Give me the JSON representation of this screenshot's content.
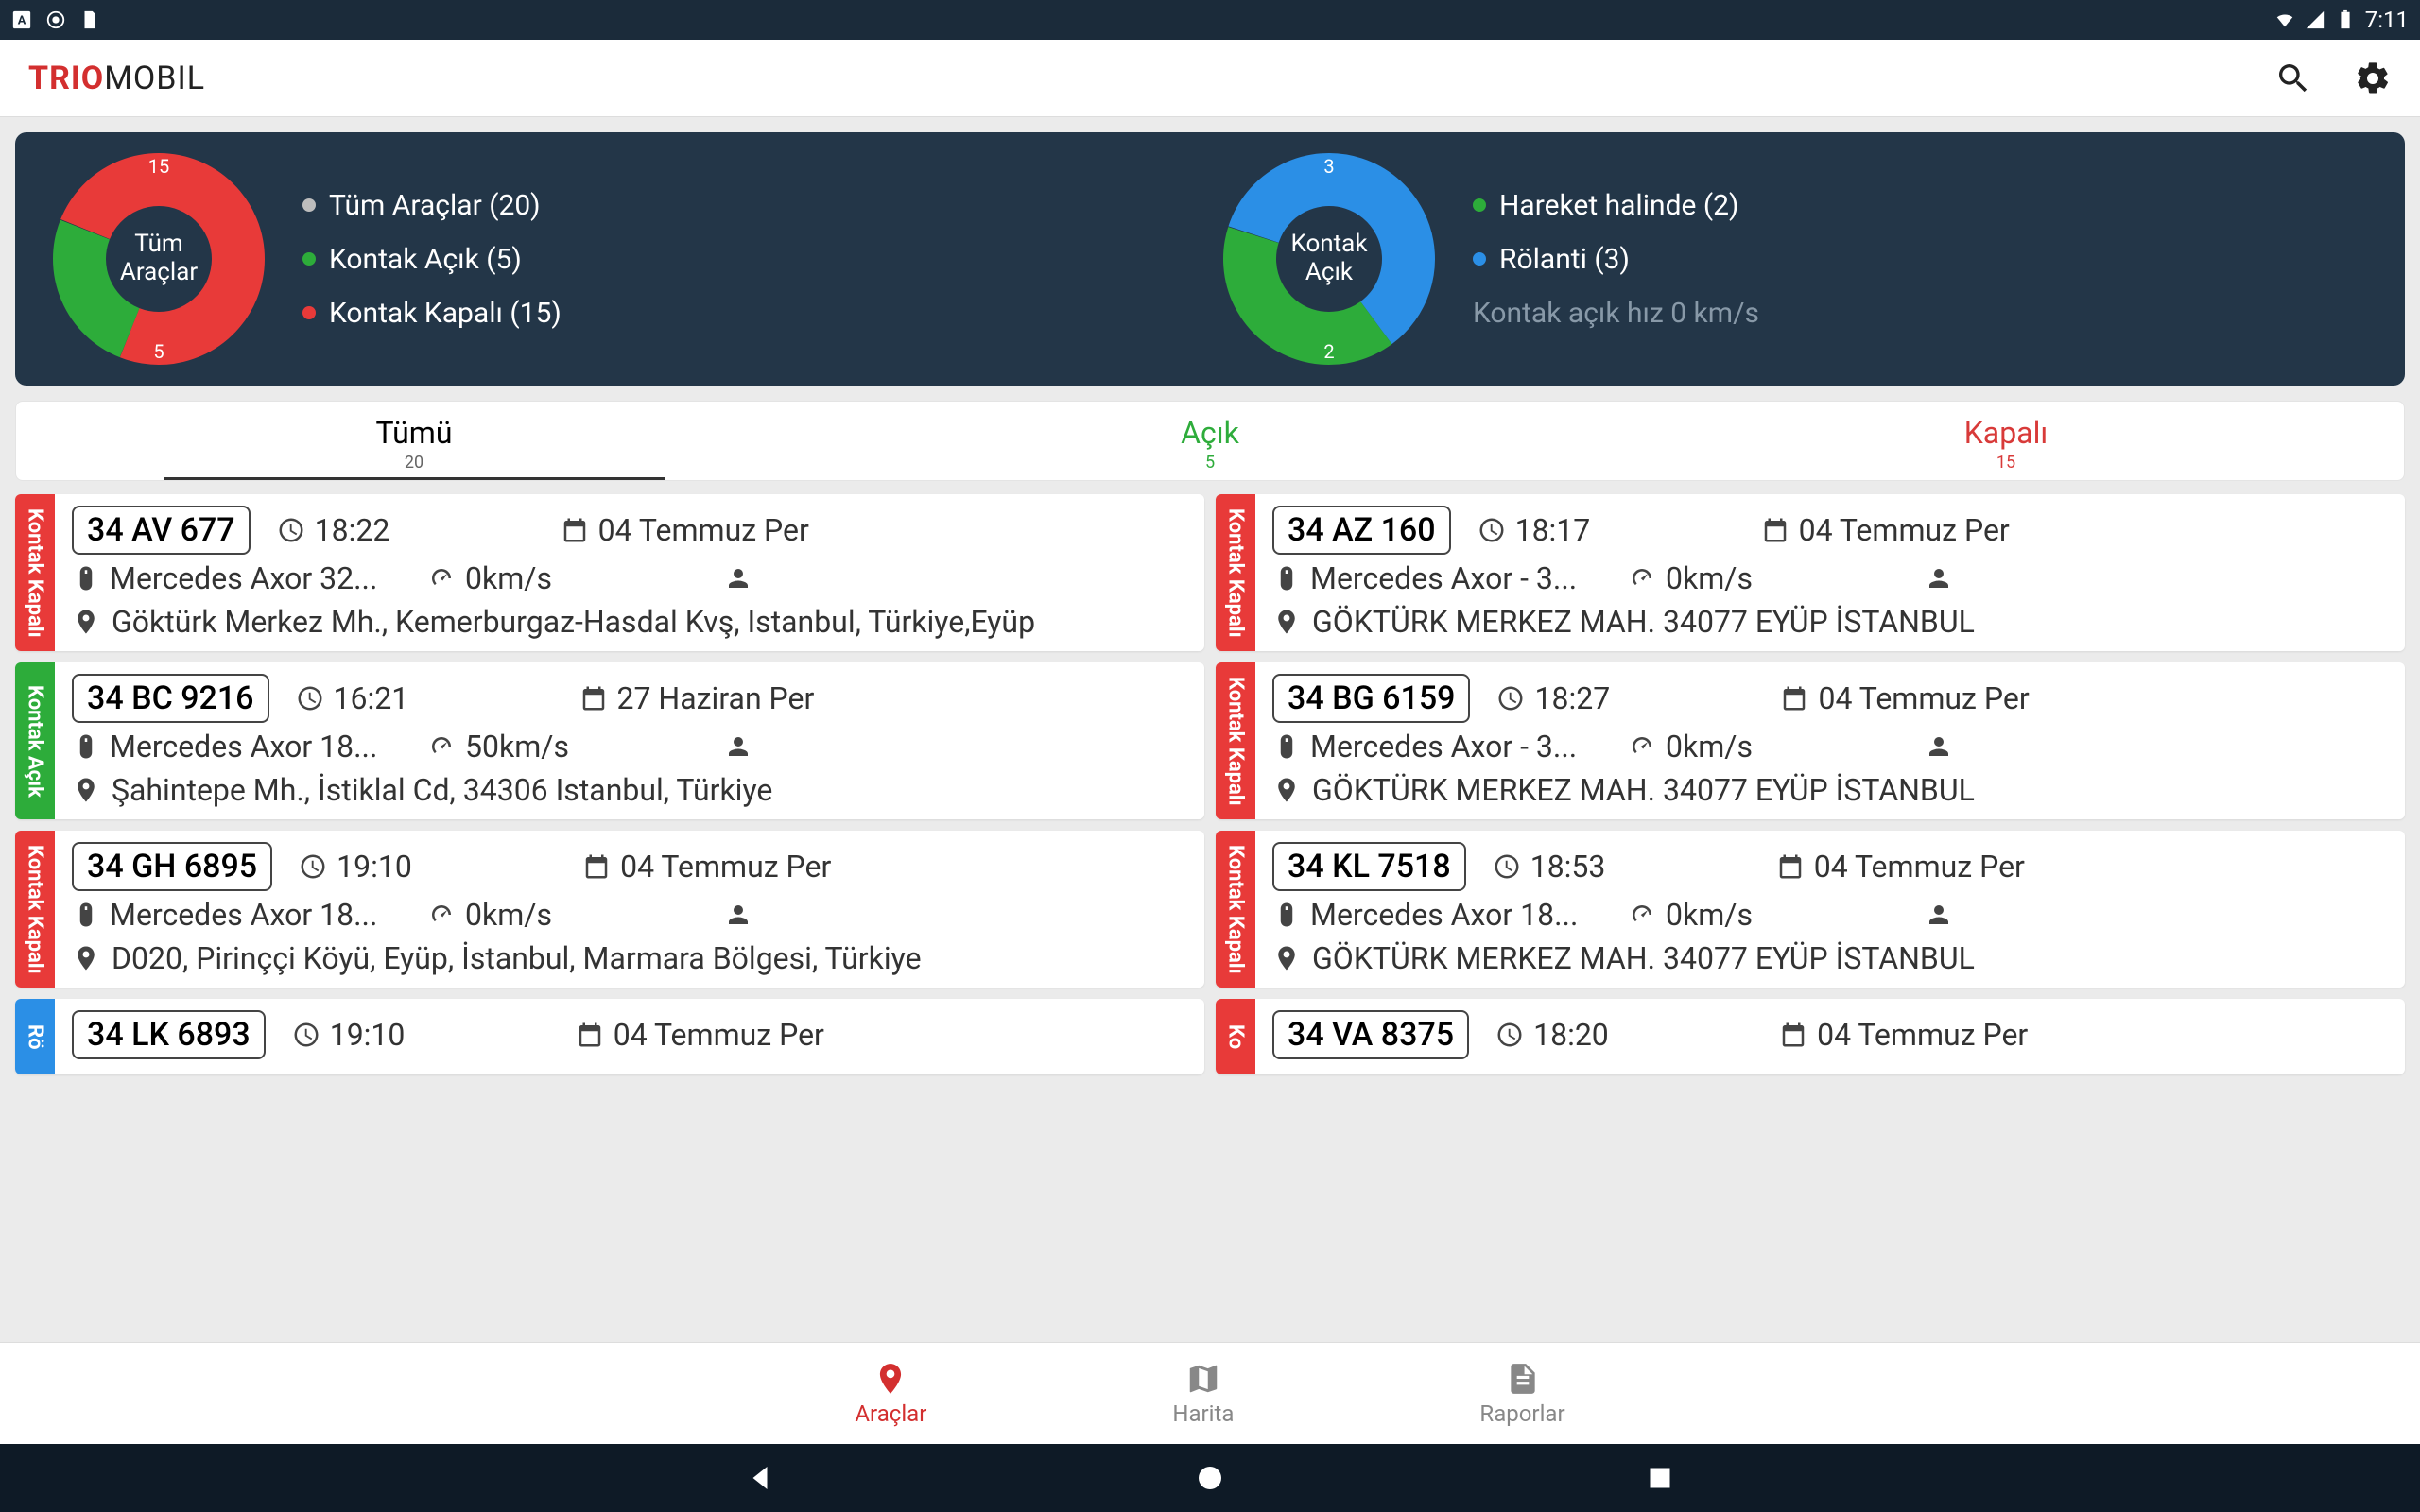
{
  "status_bar": {
    "time": "7:11"
  },
  "app": {
    "logo_trio": "TRIO",
    "logo_mobil": "MOBIL"
  },
  "dashboard": {
    "left": {
      "center_line1": "Tüm",
      "center_line2": "Araçlar",
      "badge_top": "15",
      "badge_bottom": "5",
      "legend": [
        {
          "color": "#bdbdbd",
          "label": "Tüm Araçlar (20)"
        },
        {
          "color": "#2dac3a",
          "label": "Kontak Açık (5)"
        },
        {
          "color": "#e83a39",
          "label": "Kontak Kapalı (15)"
        }
      ]
    },
    "right": {
      "center_line1": "Kontak",
      "center_line2": "Açık",
      "badge_top": "3",
      "badge_bottom": "2",
      "legend": [
        {
          "color": "#2dac3a",
          "label": "Hareket halinde (2)"
        },
        {
          "color": "#2b8fe6",
          "label": "Rölanti (3)"
        }
      ],
      "sub": "Kontak açık hız 0 km/s"
    }
  },
  "tabs": {
    "all": {
      "label": "Tümü",
      "count": "20"
    },
    "open": {
      "label": "Açık",
      "count": "5"
    },
    "closed": {
      "label": "Kapalı",
      "count": "15"
    }
  },
  "status_labels": {
    "kapali": "Kontak Kapalı",
    "acik": "Kontak Açık",
    "rolanti": "Rölanti"
  },
  "vehicles": [
    {
      "status": "kapali",
      "plate": "34 AV 677",
      "time": "18:22",
      "date": "04 Temmuz Per",
      "model": "Mercedes Axor 32...",
      "speed": "0km/s",
      "address": "Göktürk Merkez Mh., Kemerburgaz-Hasdal Kvş, Istanbul, Türkiye,Eyüp"
    },
    {
      "status": "kapali",
      "plate": "34 AZ 160",
      "time": "18:17",
      "date": "04 Temmuz Per",
      "model": "Mercedes Axor - 3...",
      "speed": "0km/s",
      "address": "GÖKTÜRK MERKEZ MAH.   34077 EYÜP İSTANBUL"
    },
    {
      "status": "acik",
      "plate": "34 BC 9216",
      "time": "16:21",
      "date": "27 Haziran Per",
      "model": "Mercedes Axor 18...",
      "speed": "50km/s",
      "address": "Şahintepe Mh., İstiklal Cd, 34306 Istanbul, Türkiye"
    },
    {
      "status": "kapali",
      "plate": "34 BG 6159",
      "time": "18:27",
      "date": "04 Temmuz Per",
      "model": "Mercedes Axor - 3...",
      "speed": "0km/s",
      "address": "GÖKTÜRK MERKEZ MAH.   34077 EYÜP İSTANBUL"
    },
    {
      "status": "kapali",
      "plate": "34 GH 6895",
      "time": "19:10",
      "date": "04 Temmuz Per",
      "model": "Mercedes Axor 18...",
      "speed": "0km/s",
      "address": "D020, Pirinççi Köyü, Eyüp, İstanbul, Marmara Bölgesi, Türkiye"
    },
    {
      "status": "kapali",
      "plate": "34 KL 7518",
      "time": "18:53",
      "date": "04 Temmuz Per",
      "model": "Mercedes Axor 18...",
      "speed": "0km/s",
      "address": "GÖKTÜRK MERKEZ MAH.   34077 EYÜP İSTANBUL"
    },
    {
      "status": "rolanti",
      "plate": "34 LK 6893",
      "time": "19:10",
      "date": "04 Temmuz Per",
      "model": "",
      "speed": "",
      "address": ""
    },
    {
      "status": "kapali",
      "plate": "34 VA 8375",
      "time": "18:20",
      "date": "04 Temmuz Per",
      "model": "",
      "speed": "",
      "address": ""
    }
  ],
  "bottom_nav": {
    "vehicles": "Araçlar",
    "map": "Harita",
    "reports": "Raporlar"
  },
  "chart_data": [
    {
      "type": "pie",
      "title": "Tüm Araçlar",
      "series": [
        {
          "name": "Kontak Kapalı",
          "value": 15,
          "color": "#e83a39"
        },
        {
          "name": "Kontak Açık",
          "value": 5,
          "color": "#2dac3a"
        }
      ],
      "total": 20
    },
    {
      "type": "pie",
      "title": "Kontak Açık",
      "series": [
        {
          "name": "Rölanti",
          "value": 3,
          "color": "#2b8fe6"
        },
        {
          "name": "Hareket halinde",
          "value": 2,
          "color": "#2dac3a"
        }
      ],
      "total": 5
    }
  ]
}
